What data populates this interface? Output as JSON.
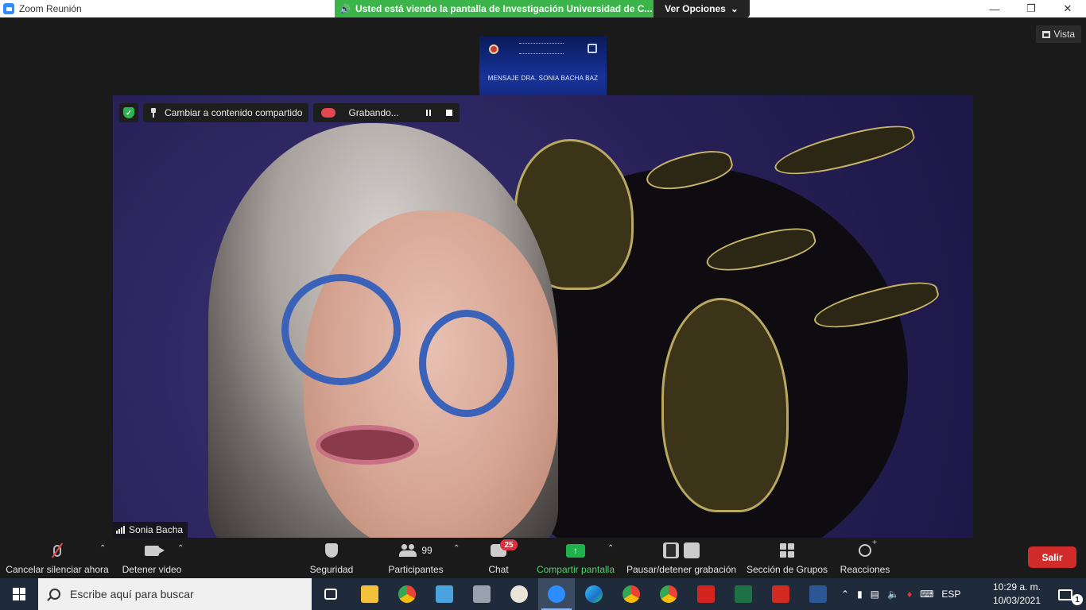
{
  "window": {
    "title": "Zoom Reunión",
    "share_banner": "Usted está viendo la pantalla de Investigación Universidad de C...",
    "view_options": "Ver Opciones",
    "view_button": "Vista"
  },
  "thumbnail": {
    "caption": "MENSAJE DRA. SONIA BACHA BAZ"
  },
  "video": {
    "switch_label": "Cambiar a contenido compartido",
    "recording_label": "Grabando...",
    "participant_name": "Sonia Bacha"
  },
  "toolbar": {
    "mute_label": "Cancelar silenciar ahora",
    "video_label": "Detener video",
    "security_label": "Seguridad",
    "participants_label": "Participantes",
    "participants_count": "99",
    "chat_label": "Chat",
    "chat_badge": "25",
    "share_label": "Compartir pantalla",
    "record_label": "Pausar/detener grabación",
    "breakout_label": "Sección de Grupos",
    "reactions_label": "Reacciones",
    "leave_label": "Salir"
  },
  "taskbar": {
    "search_placeholder": "Escribe aquí para buscar",
    "language": "ESP",
    "time": "10:29 a. m.",
    "date": "10/03/2021",
    "notification_count": "1"
  },
  "colors": {
    "share_green": "#3bb54a",
    "leave_red": "#d12c2c",
    "recording_red": "#e34850",
    "toolbar_bg": "#1a1a1a"
  }
}
